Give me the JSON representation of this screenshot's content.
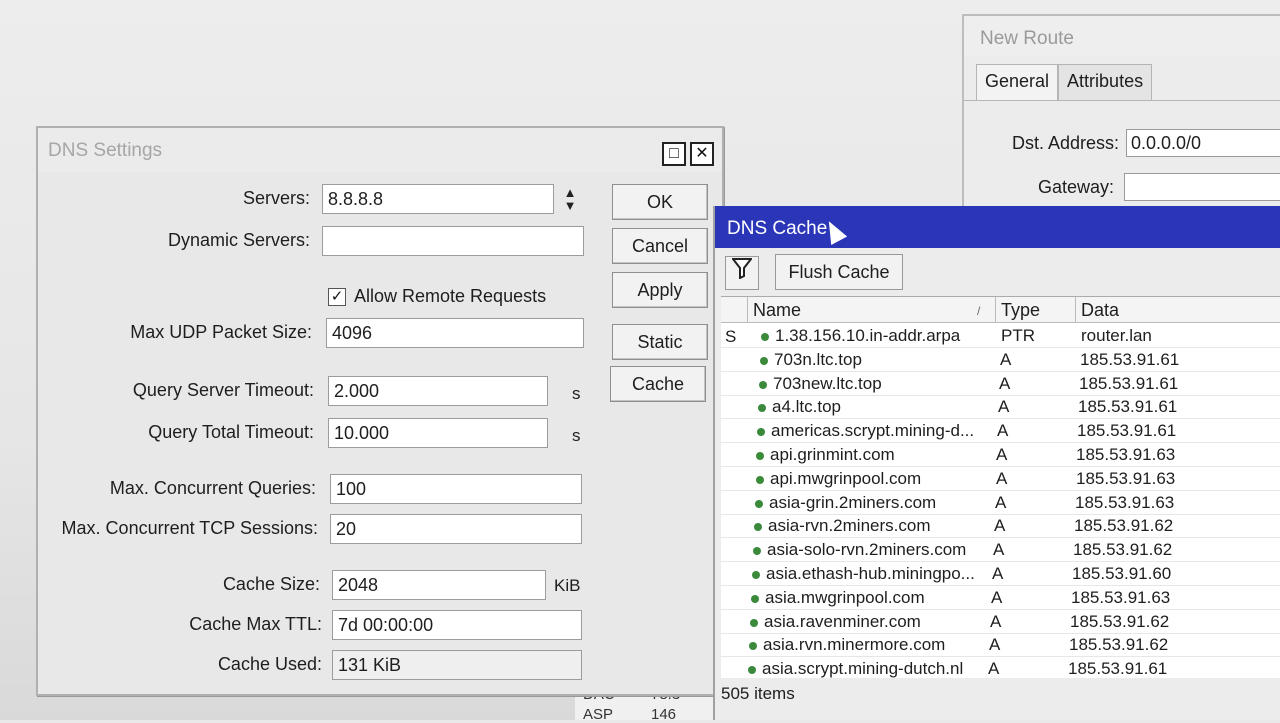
{
  "background": {
    "cells": [
      "DAC",
      "78.3",
      "ASP",
      "146"
    ]
  },
  "route_window": {
    "title": "New Route",
    "tabs": [
      "General",
      "Attributes"
    ],
    "dst_label": "Dst. Address:",
    "dst_value": "0.0.0.0/0",
    "gateway_label": "Gateway:",
    "gateway_value": ""
  },
  "dns_settings": {
    "title": "DNS Settings",
    "title_buttons": [
      "□",
      "✕"
    ],
    "servers_label": "Servers:",
    "servers_value": "8.8.8.8",
    "dynamic_label": "Dynamic Servers:",
    "dynamic_value": "",
    "allow_remote_label": "Allow Remote Requests",
    "allow_remote_checked": true,
    "max_udp_label": "Max UDP Packet Size:",
    "max_udp_value": "4096",
    "qst_label": "Query Server Timeout:",
    "qst_value": "2.000",
    "qst_unit": "s",
    "qtt_label": "Query Total Timeout:",
    "qtt_value": "10.000",
    "qtt_unit": "s",
    "mcq_label": "Max. Concurrent Queries:",
    "mcq_value": "100",
    "mcts_label": "Max. Concurrent TCP Sessions:",
    "mcts_value": "20",
    "cache_size_label": "Cache Size:",
    "cache_size_value": "2048",
    "cache_size_unit": "KiB",
    "cache_ttl_label": "Cache Max TTL:",
    "cache_ttl_value": "7d 00:00:00",
    "cache_used_label": "Cache Used:",
    "cache_used_value": "131 KiB",
    "buttons": {
      "ok": "OK",
      "cancel": "Cancel",
      "apply": "Apply",
      "static": "Static",
      "cache": "Cache"
    }
  },
  "dns_cache": {
    "title": "DNS Cache",
    "flush_label": "Flush Cache",
    "columns": {
      "name": "Name",
      "type": "Type",
      "data": "Data"
    },
    "rows": [
      {
        "flag": "S",
        "name": "1.38.156.10.in-addr.arpa",
        "type": "PTR",
        "data": "router.lan"
      },
      {
        "flag": "",
        "name": "703n.ltc.top",
        "type": "A",
        "data": "185.53.91.61"
      },
      {
        "flag": "",
        "name": "703new.ltc.top",
        "type": "A",
        "data": "185.53.91.61"
      },
      {
        "flag": "",
        "name": "a4.ltc.top",
        "type": "A",
        "data": "185.53.91.61"
      },
      {
        "flag": "",
        "name": "americas.scrypt.mining-d...",
        "type": "A",
        "data": "185.53.91.61"
      },
      {
        "flag": "",
        "name": "api.grinmint.com",
        "type": "A",
        "data": "185.53.91.63"
      },
      {
        "flag": "",
        "name": "api.mwgrinpool.com",
        "type": "A",
        "data": "185.53.91.63"
      },
      {
        "flag": "",
        "name": "asia-grin.2miners.com",
        "type": "A",
        "data": "185.53.91.63"
      },
      {
        "flag": "",
        "name": "asia-rvn.2miners.com",
        "type": "A",
        "data": "185.53.91.62"
      },
      {
        "flag": "",
        "name": "asia-solo-rvn.2miners.com",
        "type": "A",
        "data": "185.53.91.62"
      },
      {
        "flag": "",
        "name": "asia.ethash-hub.miningpo...",
        "type": "A",
        "data": "185.53.91.60"
      },
      {
        "flag": "",
        "name": "asia.mwgrinpool.com",
        "type": "A",
        "data": "185.53.91.63"
      },
      {
        "flag": "",
        "name": "asia.ravenminer.com",
        "type": "A",
        "data": "185.53.91.62"
      },
      {
        "flag": "",
        "name": "asia.rvn.minermore.com",
        "type": "A",
        "data": "185.53.91.62"
      },
      {
        "flag": "",
        "name": "asia.scrypt.mining-dutch.nl",
        "type": "A",
        "data": "185.53.91.61"
      }
    ],
    "status": "505 items"
  }
}
